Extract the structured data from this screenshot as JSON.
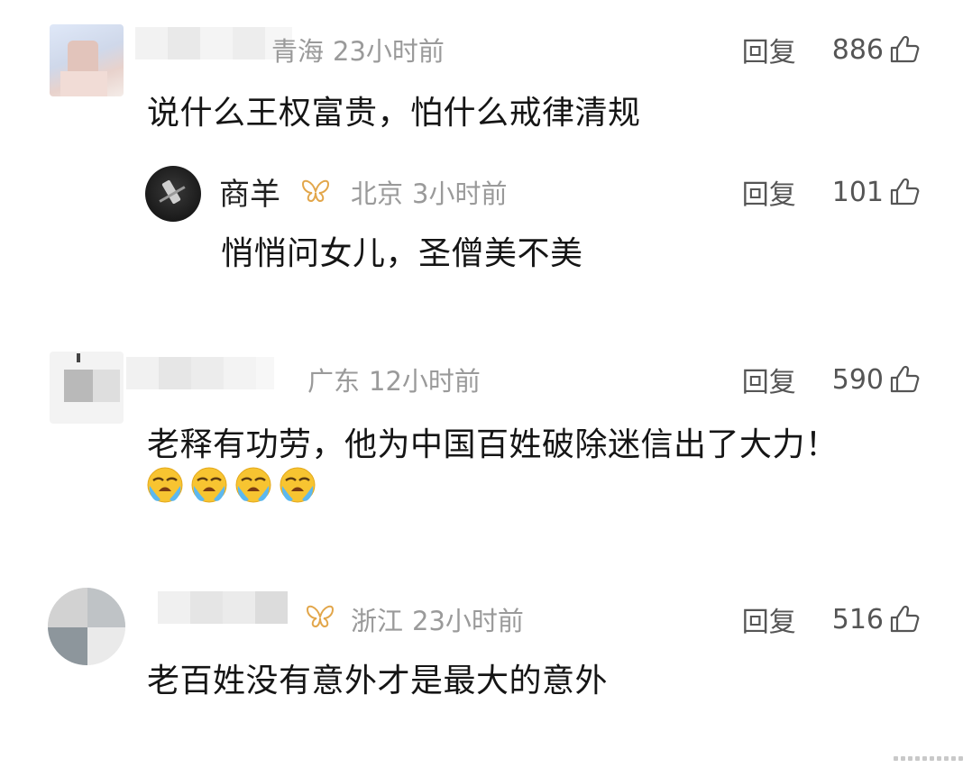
{
  "comments": [
    {
      "location": "青海",
      "time": "23小时前",
      "reply_label": "回复",
      "likes": "886",
      "text": "说什么王权富贵，怕什么戒律清规",
      "reply": {
        "username": "商羊",
        "location": "北京",
        "time": "3小时前",
        "reply_label": "回复",
        "likes": "101",
        "text": "悄悄问女儿，圣僧美不美"
      }
    },
    {
      "location": "广东",
      "time": "12小时前",
      "reply_label": "回复",
      "likes": "590",
      "text": "老释有功劳，他为中国百姓破除迷信出了大力！"
    },
    {
      "location": "浙江",
      "time": "23小时前",
      "reply_label": "回复",
      "likes": "516",
      "text": "老百姓没有意外才是最大的意外"
    }
  ],
  "icons": {
    "like": "thumbs-up-outline-icon",
    "badge": "butterfly-badge-icon",
    "emoji": "crying-face-emoji"
  },
  "colors": {
    "meta": "#9a9a9a",
    "badge": "#e2a64a",
    "text": "#151515"
  }
}
